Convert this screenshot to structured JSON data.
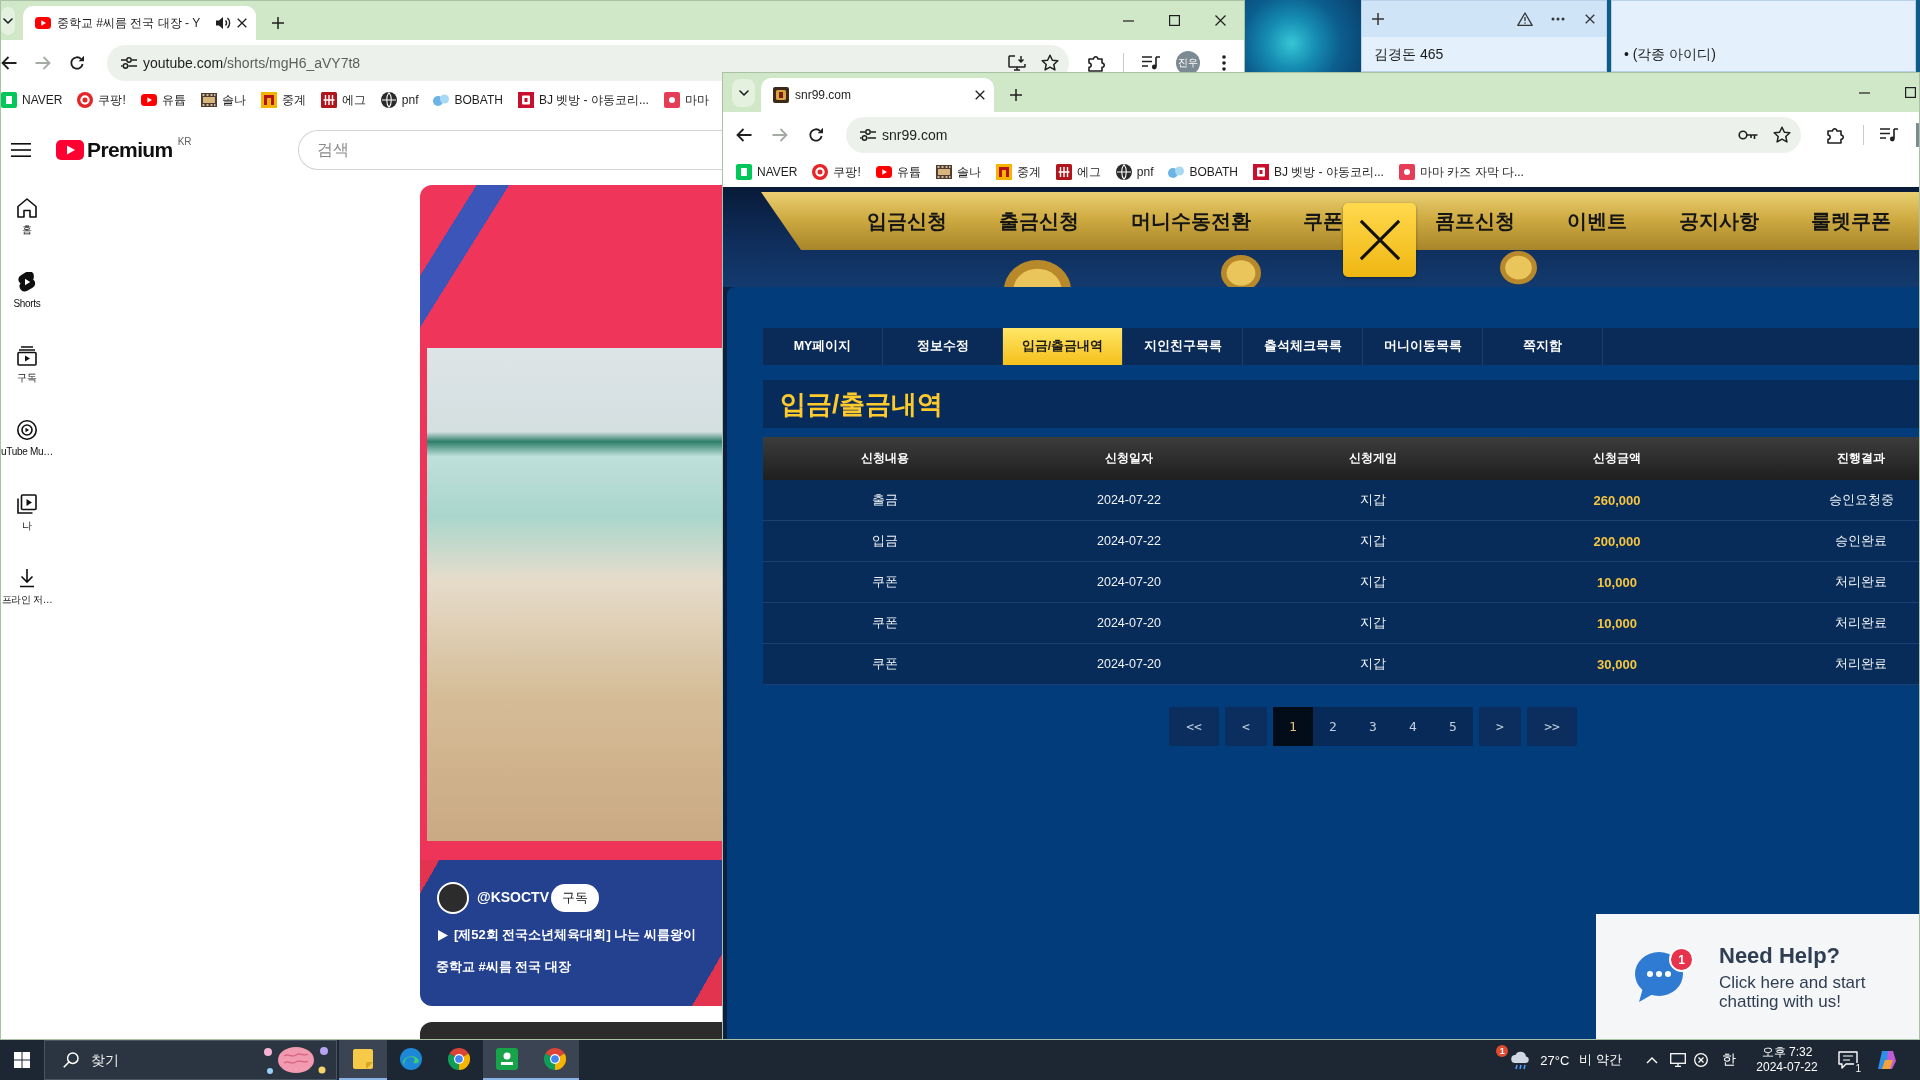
{
  "youtube_window": {
    "tab": {
      "title": "중학교 #씨름 전국 대장 - Y",
      "audio_playing": true
    },
    "toolbar": {
      "host": "youtube.com",
      "path": "/shorts/mgH6_aVY7t8",
      "forward_disabled": true,
      "profile": "진우"
    },
    "bookmarks": [
      {
        "kind": "naver",
        "label": "NAVER"
      },
      {
        "kind": "coupang",
        "label": "쿠팡!"
      },
      {
        "kind": "youtube",
        "label": "유튭"
      },
      {
        "kind": "film",
        "label": "솔나"
      },
      {
        "kind": "m",
        "label": "중계"
      },
      {
        "kind": "tile",
        "label": "에그"
      },
      {
        "kind": "globe",
        "label": "pnf"
      },
      {
        "kind": "bobath",
        "label": "BOBATH"
      },
      {
        "kind": "r",
        "label": "BJ 벳방 - 야동코리..."
      },
      {
        "kind": "y",
        "label": "마마"
      }
    ],
    "page": {
      "logo": "Premium",
      "region": "KR",
      "search": {
        "placeholder": "검색"
      },
      "sidebar": [
        {
          "kind": "home",
          "label": "홈",
          "selected": false
        },
        {
          "kind": "shorts",
          "label": "Shorts",
          "selected": true
        },
        {
          "kind": "subscriptions",
          "label": "구독",
          "selected": false
        },
        {
          "kind": "music",
          "label": "uTube Mu…",
          "selected": false
        },
        {
          "kind": "you",
          "label": "나",
          "selected": false
        },
        {
          "kind": "downloads",
          "label": "프라인 저…",
          "selected": false
        }
      ],
      "short": {
        "channel": "@KSOCTV",
        "subscribe": "구독",
        "related_video": "[제52회 전국소년체육대회] 나는 씨름왕이",
        "title": "중학교 #씨름 전국 대장"
      }
    }
  },
  "sticky_notes": [
    {
      "focused": true,
      "text": "김경돈 465"
    },
    {
      "focused": false,
      "text": "• (각종 아이디)"
    }
  ],
  "snr_window": {
    "tab": {
      "title": "snr99.com",
      "audio_playing": false
    },
    "toolbar": {
      "host": "snr99.com",
      "forward_disabled": true
    },
    "bookmarks": [
      {
        "kind": "naver",
        "label": "NAVER"
      },
      {
        "kind": "coupang",
        "label": "쿠팡!"
      },
      {
        "kind": "youtube",
        "label": "유튭"
      },
      {
        "kind": "film",
        "label": "솔나"
      },
      {
        "kind": "m",
        "label": "중계"
      },
      {
        "kind": "tile",
        "label": "에그"
      },
      {
        "kind": "globe",
        "label": "pnf"
      },
      {
        "kind": "bobath",
        "label": "BOBATH"
      },
      {
        "kind": "r",
        "label": "BJ 벳방 - 야동코리..."
      },
      {
        "kind": "y",
        "label": "마마 카즈 자막 다..."
      }
    ],
    "page": {
      "nav": [
        {
          "label": "입금신청",
          "covered": false
        },
        {
          "label": "출금신청",
          "covered": false
        },
        {
          "label": "머니수동전환",
          "covered": false
        },
        {
          "label": "쿠폰",
          "covered": true
        },
        {
          "label": "콤프신청",
          "covered": false
        },
        {
          "label": "이벤트",
          "covered": false
        },
        {
          "label": "공지사항",
          "covered": false
        },
        {
          "label": "룰렛쿠폰",
          "covered": false
        }
      ],
      "tabs": [
        {
          "label": "MY페이지",
          "selected": false
        },
        {
          "label": "정보수정",
          "selected": false
        },
        {
          "label": "입금/출금내역",
          "selected": true
        },
        {
          "label": "지인친구목록",
          "selected": false
        },
        {
          "label": "출석체크목록",
          "selected": false
        },
        {
          "label": "머니이동목록",
          "selected": false
        },
        {
          "label": "쪽지함",
          "selected": false
        }
      ],
      "heading": "입금/출금내역",
      "table": {
        "columns": [
          "신청내용",
          "신청일자",
          "신청게임",
          "신청금액",
          "진행결과"
        ],
        "rows": [
          {
            "type": "출금",
            "date": "2024-07-22",
            "game": "지갑",
            "amount": "260,000",
            "status": "승인요청중"
          },
          {
            "type": "입금",
            "date": "2024-07-22",
            "game": "지갑",
            "amount": "200,000",
            "status": "승인완료"
          },
          {
            "type": "쿠폰",
            "date": "2024-07-20",
            "game": "지갑",
            "amount": "10,000",
            "status": "처리완료"
          },
          {
            "type": "쿠폰",
            "date": "2024-07-20",
            "game": "지갑",
            "amount": "10,000",
            "status": "처리완료"
          },
          {
            "type": "쿠폰",
            "date": "2024-07-20",
            "game": "지갑",
            "amount": "30,000",
            "status": "처리완료"
          }
        ]
      },
      "pagination": {
        "first": "<<",
        "prev": "<",
        "pages": [
          {
            "label": "1",
            "selected": true
          },
          {
            "label": "2",
            "selected": false
          },
          {
            "label": "3",
            "selected": false
          },
          {
            "label": "4",
            "selected": false
          },
          {
            "label": "5",
            "selected": false
          }
        ],
        "next": ">",
        "last": ">>"
      },
      "help": {
        "badge": "1",
        "title": "Need Help?",
        "message": "Click here and start chatting with us!"
      }
    }
  },
  "taskbar": {
    "search": {
      "placeholder": "찾기"
    },
    "apps": [
      {
        "kind": "notes",
        "highlighted": true
      },
      {
        "kind": "edge",
        "highlighted": false
      },
      {
        "kind": "chrome",
        "highlighted": false
      },
      {
        "kind": "k",
        "highlighted": true
      },
      {
        "kind": "chrome",
        "highlighted": true
      }
    ],
    "weather": {
      "badge": "1",
      "temperature": "27°C",
      "condition": "비 약간"
    },
    "ime": "한",
    "time": "오후 7:32",
    "date": "2024-07-22",
    "notifications": "1"
  }
}
